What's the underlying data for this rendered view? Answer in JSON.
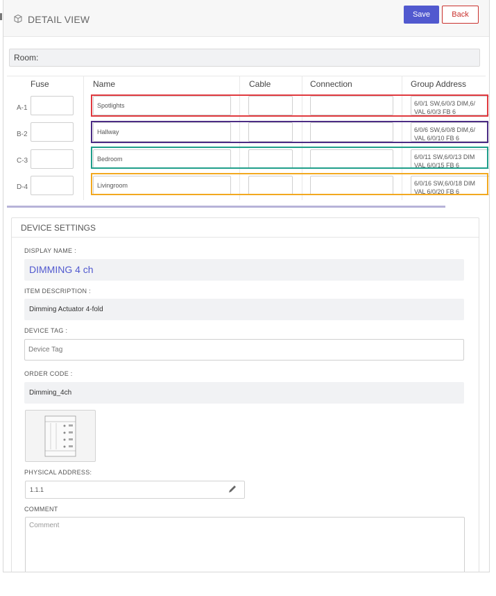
{
  "header": {
    "title": "DETAIL VIEW",
    "save_label": "Save",
    "back_label": "Back"
  },
  "room": {
    "label": "Room:"
  },
  "table": {
    "columns": [
      "Fuse",
      "Name",
      "Cable",
      "Connection",
      "Group Address"
    ],
    "rows": [
      {
        "fuse_label": "A-1",
        "name": "Spotlights",
        "group_address": "6/0/1 SW,6/0/3 DIM,6/",
        "group_address_2": "VAL 6/0/3 FB 6",
        "highlight": "#e0393e"
      },
      {
        "fuse_label": "B-2",
        "name": "Hallway",
        "group_address": "6/0/6 SW,6/0/8 DIM,6/",
        "group_address_2": "VAL 6/0/10 FB 6",
        "highlight": "#4b2c84"
      },
      {
        "fuse_label": "C-3",
        "name": "Bedroom",
        "group_address": "6/0/11 SW,6/0/13 DIM",
        "group_address_2": "VAL 6/0/15 FB 6",
        "highlight": "#1f9e8a"
      },
      {
        "fuse_label": "D-4",
        "name": "Livingroom",
        "group_address": "6/0/16 SW,6/0/18 DIM",
        "group_address_2": "VAL 6/0/20 FB 6",
        "highlight": "#f2a81f"
      }
    ]
  },
  "device_settings": {
    "title": "DEVICE SETTINGS",
    "display_name_label": "DISPLAY NAME :",
    "display_name": "DIMMING 4 ch",
    "item_description_label": "ITEM DESCRIPTION :",
    "item_description": "Dimming Actuator 4-fold",
    "device_tag_label": "DEVICE TAG :",
    "device_tag_placeholder": "Device Tag",
    "order_code_label": "ORDER CODE :",
    "order_code": "Dimming_4ch",
    "physical_address_label": "PHYSICAL ADDRESS:",
    "physical_address": "1.1.1",
    "comment_label": "COMMENT",
    "comment_placeholder": "Comment"
  },
  "colors": {
    "accent": "#5159cf",
    "danger": "#c9302c",
    "display_name": "#5159cf"
  },
  "icons": {
    "header": "cube-icon",
    "edit": "pencil-icon",
    "device": "device-image"
  }
}
